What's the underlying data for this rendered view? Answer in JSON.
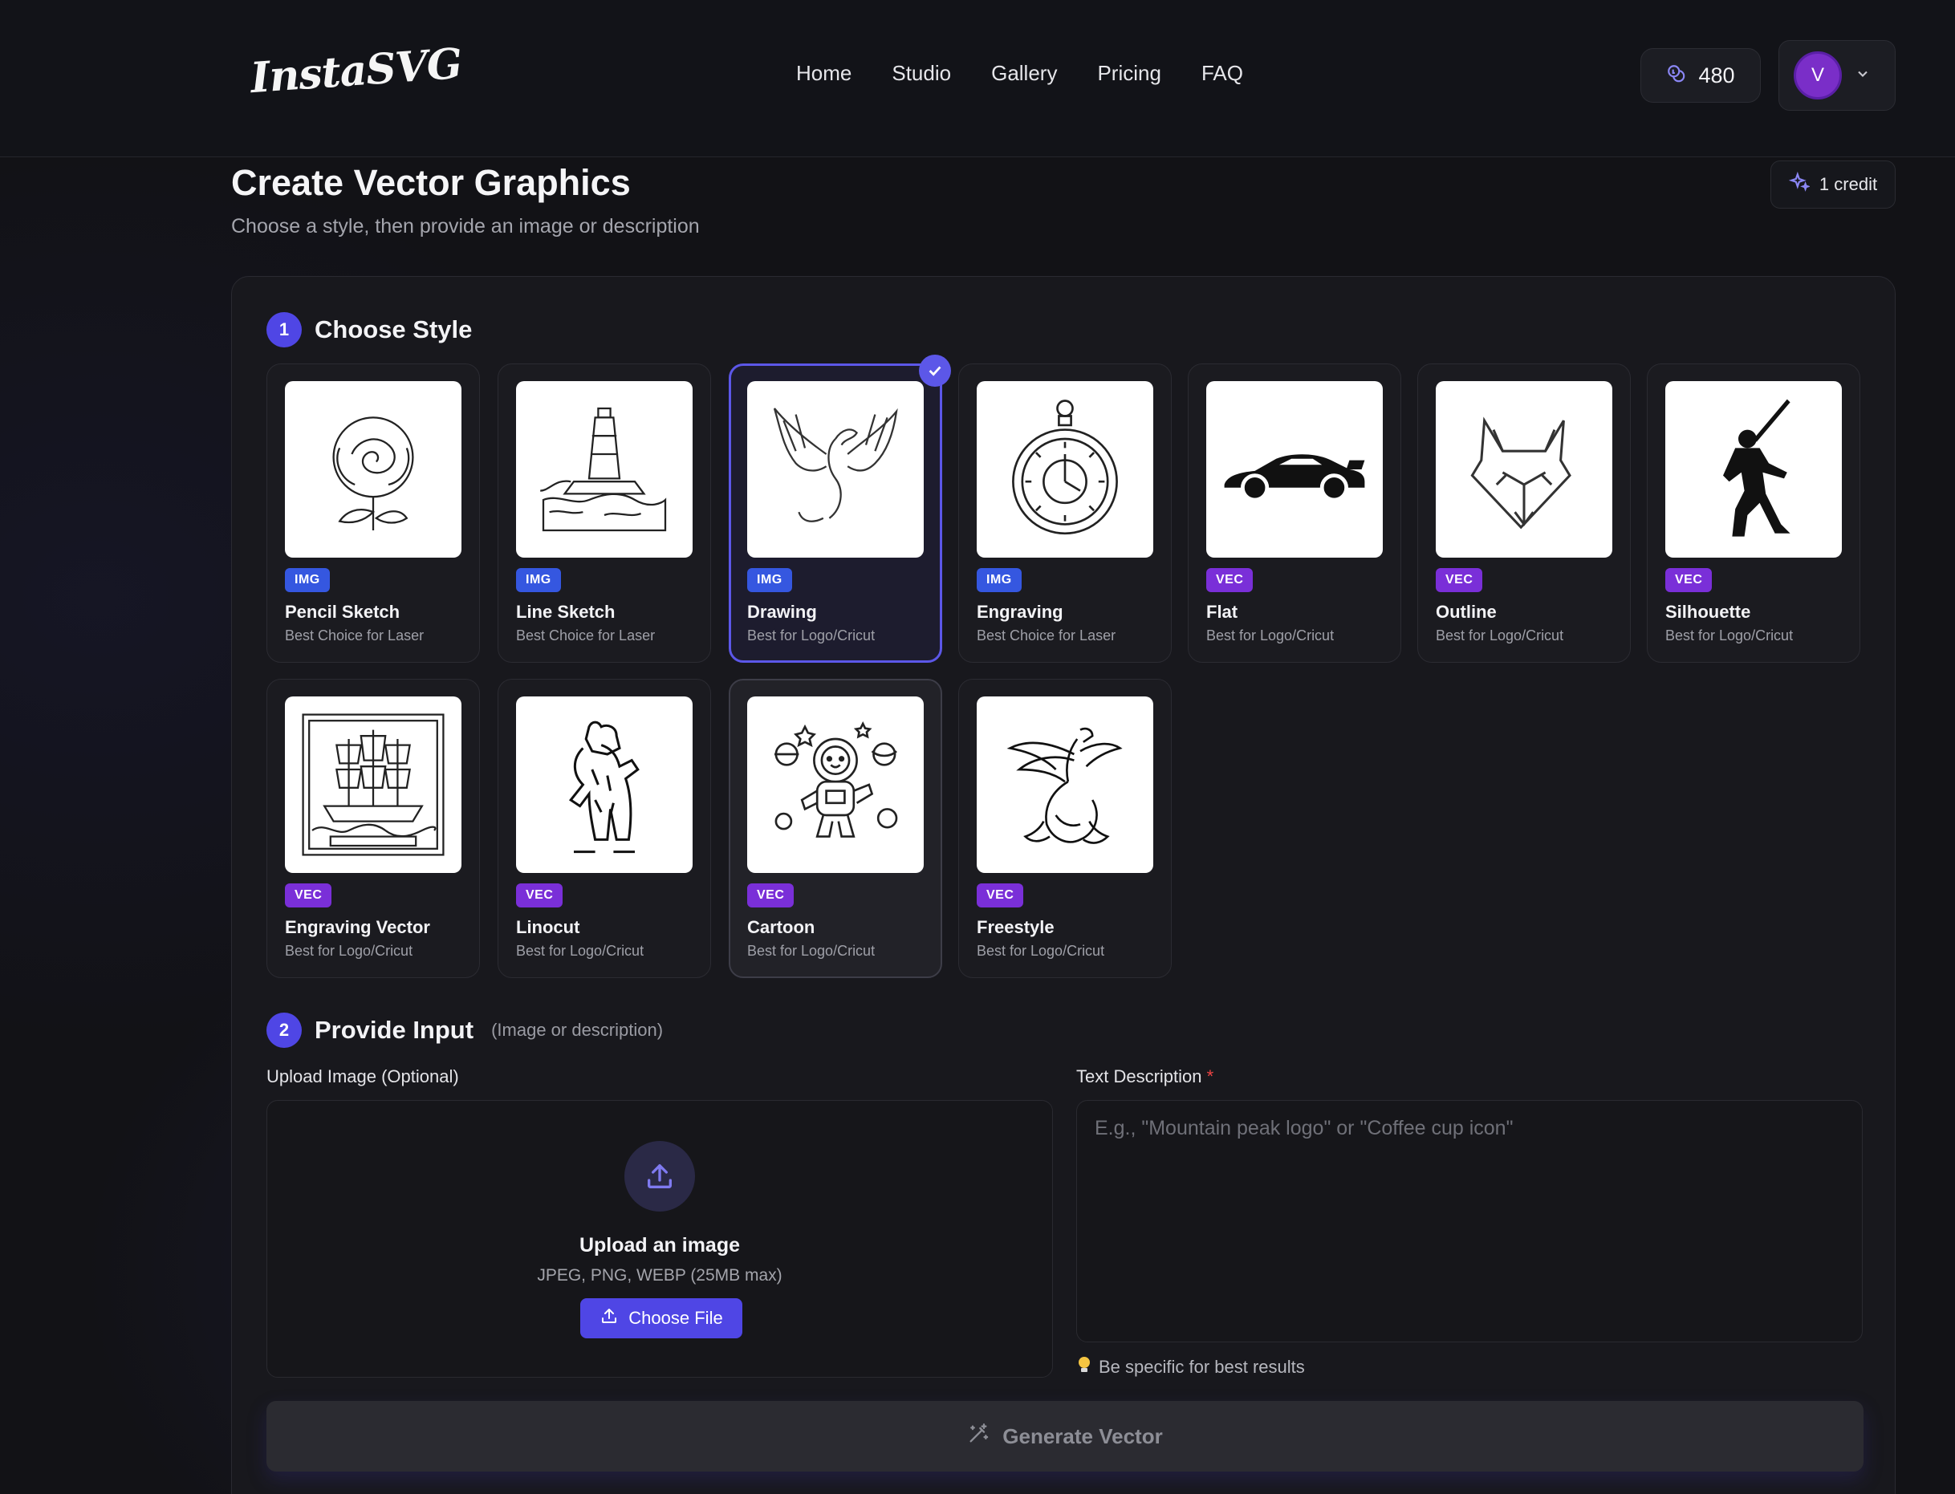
{
  "header": {
    "logo": "InstaSVG",
    "nav": [
      {
        "label": "Home"
      },
      {
        "label": "Studio"
      },
      {
        "label": "Gallery"
      },
      {
        "label": "Pricing"
      },
      {
        "label": "FAQ"
      }
    ],
    "credits": "480",
    "avatar_initial": "V"
  },
  "page": {
    "title": "Create Vector Graphics",
    "subtitle": "Choose a style, then provide an image or description",
    "cost_badge": "1 credit"
  },
  "step1": {
    "number": "1",
    "title": "Choose Style"
  },
  "styles": [
    {
      "tag": "IMG",
      "name": "Pencil Sketch",
      "desc": "Best Choice for Laser",
      "icon": "rose-sketch-icon"
    },
    {
      "tag": "IMG",
      "name": "Line Sketch",
      "desc": "Best Choice for Laser",
      "icon": "lighthouse-sketch-icon"
    },
    {
      "tag": "IMG",
      "name": "Drawing",
      "desc": "Best for Logo/Cricut",
      "icon": "dragon-drawing-icon",
      "selected": true
    },
    {
      "tag": "IMG",
      "name": "Engraving",
      "desc": "Best Choice for Laser",
      "icon": "pocket-watch-icon"
    },
    {
      "tag": "VEC",
      "name": "Flat",
      "desc": "Best for Logo/Cricut",
      "icon": "sports-car-icon"
    },
    {
      "tag": "VEC",
      "name": "Outline",
      "desc": "Best for Logo/Cricut",
      "icon": "fox-outline-icon"
    },
    {
      "tag": "VEC",
      "name": "Silhouette",
      "desc": "Best for Logo/Cricut",
      "icon": "samurai-silhouette-icon"
    },
    {
      "tag": "VEC",
      "name": "Engraving Vector",
      "desc": "Best for Logo/Cricut",
      "icon": "ship-engraving-icon"
    },
    {
      "tag": "VEC",
      "name": "Linocut",
      "desc": "Best for Logo/Cricut",
      "icon": "bear-linocut-icon"
    },
    {
      "tag": "VEC",
      "name": "Cartoon",
      "desc": "Best for Logo/Cricut",
      "icon": "astronaut-cartoon-icon"
    },
    {
      "tag": "VEC",
      "name": "Freestyle",
      "desc": "Best for Logo/Cricut",
      "icon": "phoenix-freestyle-icon"
    }
  ],
  "step2": {
    "number": "2",
    "title": "Provide Input",
    "hint": "(Image or description)"
  },
  "upload": {
    "label": "Upload Image (Optional)",
    "title": "Upload an image",
    "types": "JPEG, PNG, WEBP (25MB max)",
    "button": "Choose File"
  },
  "description": {
    "label": "Text Description",
    "required_mark": "*",
    "placeholder": "E.g., \"Mountain peak logo\" or \"Coffee cup icon\"",
    "value": "",
    "tip": "Be specific for best results"
  },
  "generate_button": "Generate Vector",
  "colors": {
    "accent": "#4f46e5",
    "img_tag": "#3557e0",
    "vec_tag": "#7a2fd8",
    "avatar": "#7a2ec8",
    "background": "#121216"
  }
}
